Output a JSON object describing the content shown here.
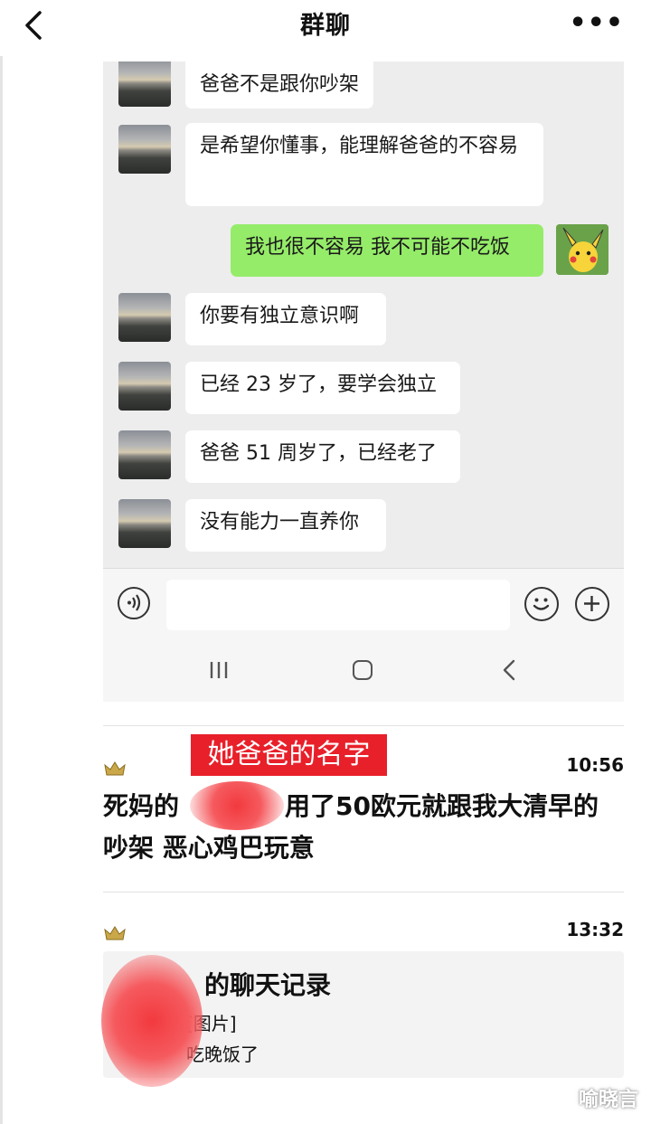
{
  "header": {
    "title": "群聊",
    "more_label": "•••"
  },
  "inner_chat": {
    "messages": [
      {
        "side": "left",
        "text": "爸爸不是跟你吵架"
      },
      {
        "side": "left",
        "text": "是希望你懂事，能理解爸爸的不容易"
      },
      {
        "side": "right",
        "text": "我也很不容易 我不可能不吃饭"
      },
      {
        "side": "left",
        "text": "你要有独立意识啊"
      },
      {
        "side": "left",
        "text": "已经 23 岁了，要学会独立"
      },
      {
        "side": "left",
        "text": "爸爸 51 周岁了，已经老了"
      },
      {
        "side": "left",
        "text": "没有能力一直养你"
      }
    ]
  },
  "outer_chat": {
    "red_label": "她爸爸的名字",
    "message1": {
      "time": "10:56",
      "line1_prefix": "死妈的",
      "line1_suffix": "用了50欧元就跟我大清早的",
      "line2": "吵架 恶心鸡巴玩意"
    },
    "message2": {
      "time": "13:32",
      "card_title": "的聊天记录",
      "card_line1": "[图片]",
      "card_line2": "吃晚饭了"
    }
  },
  "watermark": "喻晓言",
  "colors": {
    "chat_bg": "#ededed",
    "green_bubble": "#95ec69",
    "red_label": "#e8202a"
  }
}
